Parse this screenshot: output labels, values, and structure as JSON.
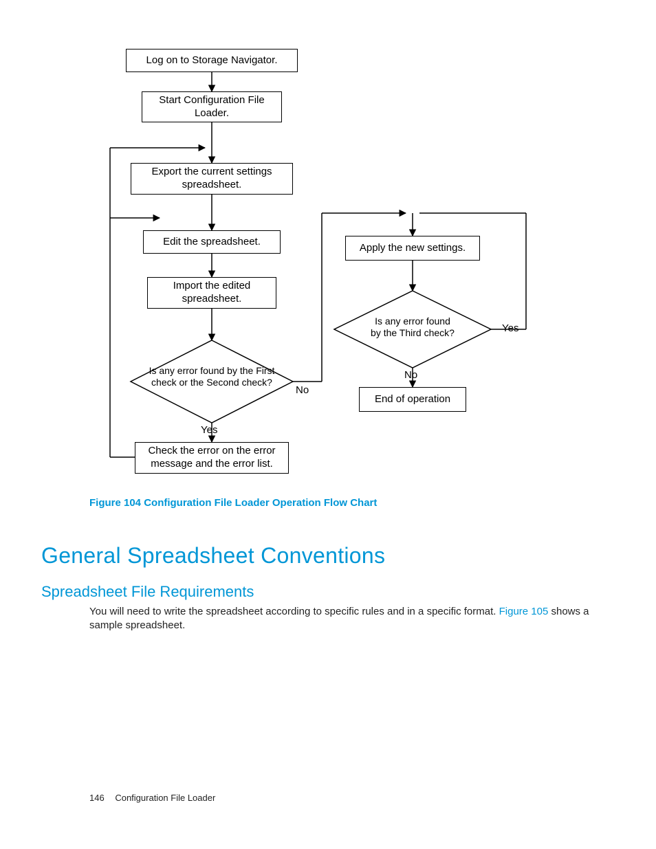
{
  "flow": {
    "box_logon": "Log on to Storage Navigator.",
    "box_start_l1": "Start Configuration File",
    "box_start_l2": "Loader.",
    "box_export_l1": "Export the current settings",
    "box_export_l2": "spreadsheet.",
    "box_edit": "Edit the spreadsheet.",
    "box_import_l1": "Import the edited",
    "box_import_l2": "spreadsheet.",
    "dec1_l1": "Is any error found by the First",
    "dec1_l2": "check or the Second check?",
    "box_checkerr_l1": "Check the error on the error",
    "box_checkerr_l2": "message and the error list.",
    "box_apply": "Apply the new settings.",
    "dec2_l1": "Is any error found",
    "dec2_l2": "by the Third check?",
    "box_end": "End of operation",
    "lbl_no": "No",
    "lbl_yes": "Yes"
  },
  "caption": "Figure 104 Configuration File Loader Operation Flow Chart",
  "h1": "General Spreadsheet Conventions",
  "h2": "Spreadsheet File Requirements",
  "body_p1_a": "You will need to write the spreadsheet according to specific rules and in a specific format. ",
  "body_p1_link": "Figure 105",
  "body_p1_b": " shows a sample spreadsheet.",
  "footer_page": "146",
  "footer_title": "Configuration File Loader"
}
